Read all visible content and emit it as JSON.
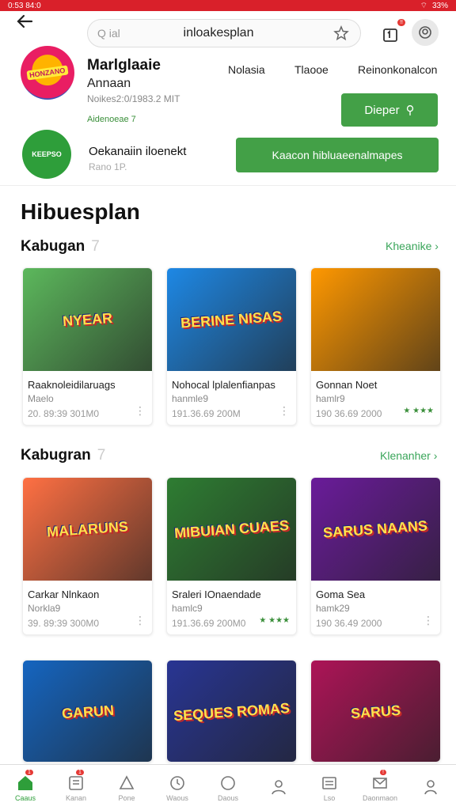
{
  "status": {
    "time": "0:53 84:0",
    "battery": "33%"
  },
  "search": {
    "query": "inloakesplan",
    "search_icon_text": "Q ial"
  },
  "cart": {
    "badge": "!!"
  },
  "featured": {
    "app1": {
      "logo": "HONZANO",
      "name": "Marlglaaie",
      "subtitle": "Annaan",
      "meta": "Noikes2:0/1983.2 MIT",
      "rating": "Aidenoeae 7"
    },
    "links": [
      "Nolasia",
      "Tlaooe",
      "Reinonkonalcon"
    ],
    "action_button": "Dieper",
    "app2": {
      "logo": "KEEPSO",
      "name": "Oekanaiin iloenekt",
      "meta": "Rano 1P."
    },
    "wide_button": "Kaacon hibluaeenalmapes"
  },
  "page_title": "Hibuesplan",
  "sections": [
    {
      "title": "Kabugan",
      "count": "7",
      "more": "Kheanike",
      "cards": [
        {
          "art": "NYEAR",
          "title": "Raaknoleidilaruags",
          "sub": "Maelo",
          "meta": "20. 89:39 301M0",
          "bg": "#5cb85c"
        },
        {
          "art": "BERINE NISAS",
          "title": "Nohocal lplalenfianpas",
          "sub": "hanmle9",
          "meta": "191.36.69 200M",
          "bg": "#1e88e5"
        },
        {
          "art": "",
          "title": "Gonnan Noet",
          "sub": "hamlr9",
          "meta": "190 36.69 2000",
          "bg": "#ff9800",
          "rank": "★ ★★★"
        }
      ]
    },
    {
      "title": "Kabugran",
      "count": "7",
      "more": "Klenanher",
      "cards": [
        {
          "art": "MALARUNS",
          "title": "Carkar Nlnkaon",
          "sub": "Norkla9",
          "meta": "39. 89:39 300M0",
          "bg": "#ff7043"
        },
        {
          "art": "MIBUIAN CUAES",
          "title": "Sraleri IOnaendade",
          "sub": "hamlc9",
          "meta": "191.36.69 200M0",
          "bg": "#2e7d32",
          "rank": "★ ★★★"
        },
        {
          "art": "SARUS NAANS",
          "title": "Goma Sea",
          "sub": "hamk29",
          "meta": "190 36.49 2000",
          "bg": "#6a1b9a"
        }
      ]
    },
    {
      "title": "",
      "count": "",
      "more": "",
      "cards": [
        {
          "art": "GARUN",
          "title": "",
          "sub": "",
          "meta": "",
          "bg": "#1565c0"
        },
        {
          "art": "SEQUES ROMAS",
          "title": "",
          "sub": "",
          "meta": "",
          "bg": "#283593"
        },
        {
          "art": "SARUS",
          "title": "",
          "sub": "",
          "meta": "",
          "bg": "#ad1457"
        }
      ]
    }
  ],
  "tabbar": [
    {
      "label": "Caaus",
      "icon": "home-icon",
      "badge": "1",
      "active": true
    },
    {
      "label": "Kanan",
      "icon": "news-icon",
      "badge": "1"
    },
    {
      "label": "Pone",
      "icon": "triangle-icon"
    },
    {
      "label": "Waous",
      "icon": "clock-icon"
    },
    {
      "label": "Daous",
      "icon": "circle-icon"
    },
    {
      "label": "",
      "icon": "person-icon"
    },
    {
      "label": "Lso",
      "icon": "list-icon"
    },
    {
      "label": "Daonmaon",
      "icon": "mail-icon",
      "badge": "!"
    },
    {
      "label": "",
      "icon": "profile-icon"
    }
  ],
  "colors": {
    "status_bar": "#d9202a",
    "accent_green": "#43a047",
    "link_green": "#3aa55a"
  }
}
